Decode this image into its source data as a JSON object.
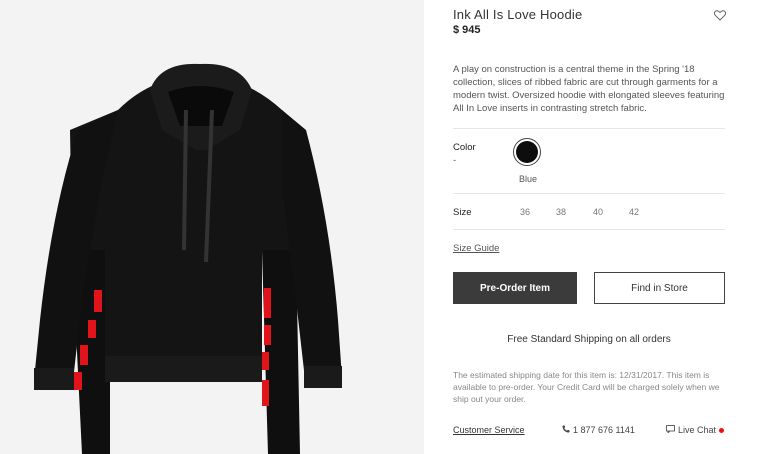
{
  "product": {
    "title": "Ink All Is Love Hoodie",
    "price": "$ 945",
    "description": "A play on construction is a central theme in the Spring '18 collection, slices of ribbed fabric are cut through garments for a modern twist. Oversized hoodie with elongated sleeves featuring All In Love inserts in contrasting stretch fabric."
  },
  "color": {
    "label": "Color",
    "value": "-",
    "swatch_name": "Blue",
    "swatch_color": "#0d0d0d"
  },
  "size": {
    "label": "Size",
    "options": [
      "36",
      "38",
      "40",
      "42"
    ]
  },
  "size_guide": "Size Guide",
  "actions": {
    "preorder": "Pre-Order Item",
    "find_store": "Find in Store"
  },
  "shipping": "Free Standard Shipping on all orders",
  "estimate": "The estimated shipping date for this item is: 12/31/2017. This item is available to pre-order. Your Credit Card will be charged solely when we ship out your order.",
  "footer": {
    "customer_service": "Customer Service",
    "phone": "1 877 676 1141",
    "live_chat": "Live Chat"
  },
  "icons": {
    "wishlist": "heart-icon",
    "phone": "phone-icon",
    "chat": "chat-icon"
  },
  "colors": {
    "primary_button": "#3b3b3b",
    "live_dot": "#ee1111",
    "accent_red": "#e0141a"
  }
}
